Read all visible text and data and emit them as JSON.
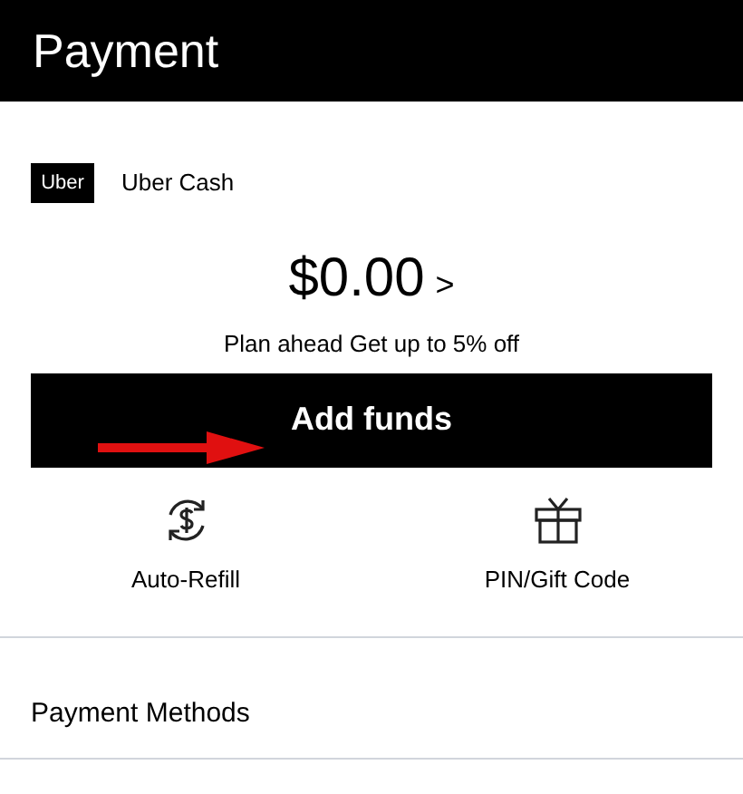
{
  "header": {
    "title": "Payment"
  },
  "uber_cash": {
    "logo": "Uber",
    "label": "Uber Cash",
    "balance": "$0.00",
    "chevron": ">",
    "promo": "Plan ahead Get up to 5% off",
    "button": "Add funds"
  },
  "actions": [
    {
      "kind": "refill",
      "label": "Auto-Refill"
    },
    {
      "kind": "gift",
      "label": "PIN/Gift Code"
    }
  ],
  "section": {
    "title": "Payment Methods"
  }
}
